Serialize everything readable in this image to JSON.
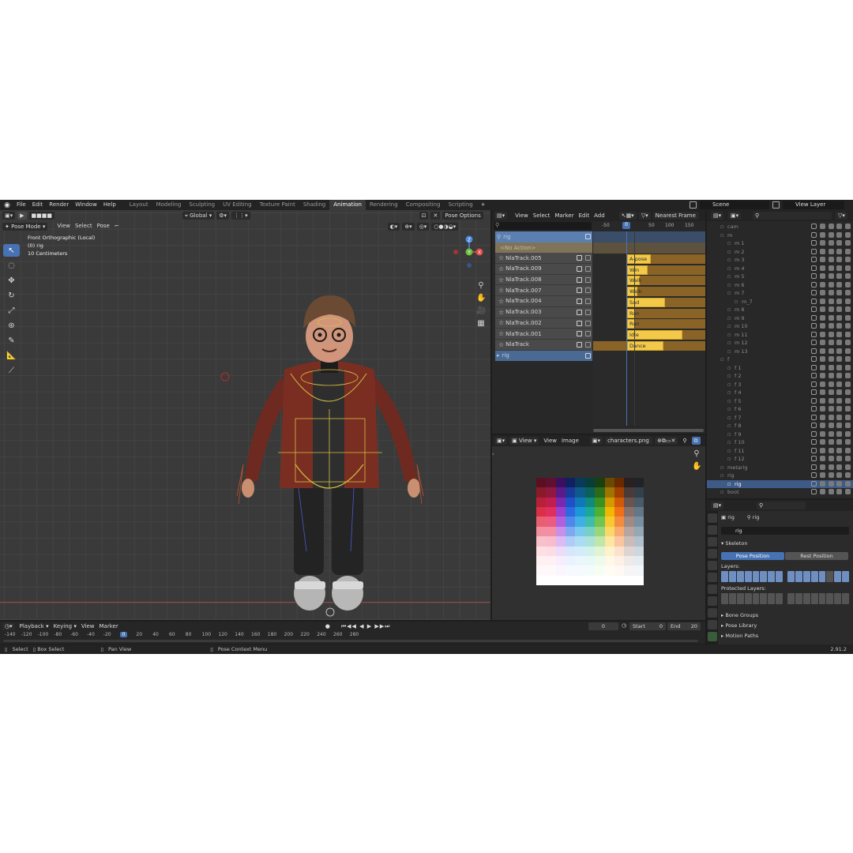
{
  "topbar": {
    "menus": [
      "File",
      "Edit",
      "Render",
      "Window",
      "Help"
    ],
    "workspaces": [
      "Layout",
      "Modeling",
      "Sculpting",
      "UV Editing",
      "Texture Paint",
      "Shading",
      "Animation",
      "Rendering",
      "Compositing",
      "Scripting"
    ],
    "active_workspace": "Animation",
    "add_tab": "+",
    "scene": "Scene",
    "view_layer": "View Layer"
  },
  "viewport": {
    "mode": "Pose Mode",
    "menus": [
      "View",
      "Select",
      "Pose"
    ],
    "transform_orientation": "Global",
    "pose_options": "Pose Options",
    "view_name": "Front Orthographic (Local)",
    "object_name": "(0) rig",
    "scale_text": "10 Centimeters",
    "gizmo": {
      "x": "X",
      "y": "Y",
      "z": "Z"
    }
  },
  "nla": {
    "menus": [
      "View",
      "Select",
      "Marker",
      "Edit",
      "Add"
    ],
    "snap": "Nearest Frame",
    "ruler": [
      "-50",
      "0",
      "50",
      "100",
      "150"
    ],
    "current_frame": "0",
    "rig_label": "rig",
    "no_action": "<No Action>",
    "tracks": [
      {
        "name": "NlaTrack.005",
        "strip": "A-pose",
        "value": 30
      },
      {
        "name": "NlaTrack.009",
        "strip": "Win",
        "value": 26
      },
      {
        "name": "NlaTrack.008",
        "strip": "Walk (I",
        "value": 16
      },
      {
        "name": "NlaTrack.007",
        "strip": "Walk",
        "value": 13
      },
      {
        "name": "NlaTrack.004",
        "strip": "Sad",
        "value": 48
      },
      {
        "name": "NlaTrack.003",
        "strip": "Run",
        "value": 7
      },
      {
        "name": "NlaTrack.002",
        "strip": "Run",
        "value": 7
      },
      {
        "name": "NlaTrack.001",
        "strip": "Idle",
        "value": 70
      },
      {
        "name": "NlaTrack",
        "strip": "Dance",
        "value": 46
      }
    ],
    "bottom_rig": "rig"
  },
  "image_editor": {
    "menus": [
      "View",
      "View",
      "Image"
    ],
    "image_name": "characters.png"
  },
  "outliner": {
    "rows": [
      {
        "name": "cam",
        "depth": 2,
        "sel": false
      },
      {
        "name": "m",
        "depth": 2,
        "sel": false
      },
      {
        "name": "m 1",
        "depth": 3,
        "sel": false
      },
      {
        "name": "m 2",
        "depth": 3,
        "sel": false
      },
      {
        "name": "m 3",
        "depth": 3,
        "sel": false
      },
      {
        "name": "m 4",
        "depth": 3,
        "sel": false
      },
      {
        "name": "m 5",
        "depth": 3,
        "sel": false
      },
      {
        "name": "m 6",
        "depth": 3,
        "sel": false
      },
      {
        "name": "m 7",
        "depth": 3,
        "sel": false
      },
      {
        "name": "m_7",
        "depth": 4,
        "sel": false
      },
      {
        "name": "m 8",
        "depth": 3,
        "sel": false
      },
      {
        "name": "m 9",
        "depth": 3,
        "sel": false
      },
      {
        "name": "m 10",
        "depth": 3,
        "sel": false
      },
      {
        "name": "m 11",
        "depth": 3,
        "sel": false
      },
      {
        "name": "m 12",
        "depth": 3,
        "sel": false
      },
      {
        "name": "m 13",
        "depth": 3,
        "sel": false
      },
      {
        "name": "f",
        "depth": 2,
        "sel": false
      },
      {
        "name": "f 1",
        "depth": 3,
        "sel": false
      },
      {
        "name": "f 2",
        "depth": 3,
        "sel": false
      },
      {
        "name": "f 3",
        "depth": 3,
        "sel": false
      },
      {
        "name": "f 4",
        "depth": 3,
        "sel": false
      },
      {
        "name": "f 5",
        "depth": 3,
        "sel": false
      },
      {
        "name": "f 6",
        "depth": 3,
        "sel": false
      },
      {
        "name": "f 7",
        "depth": 3,
        "sel": false
      },
      {
        "name": "f 8",
        "depth": 3,
        "sel": false
      },
      {
        "name": "f 9",
        "depth": 3,
        "sel": false
      },
      {
        "name": "f 10",
        "depth": 3,
        "sel": false
      },
      {
        "name": "f 11",
        "depth": 3,
        "sel": false
      },
      {
        "name": "f 12",
        "depth": 3,
        "sel": false
      },
      {
        "name": "metarig",
        "depth": 2,
        "sel": false
      },
      {
        "name": "rig",
        "depth": 2,
        "sel": false
      },
      {
        "name": "rig",
        "depth": 3,
        "sel": true
      },
      {
        "name": "boot",
        "depth": 2,
        "sel": false
      }
    ]
  },
  "properties": {
    "object": "rig",
    "data": "rig",
    "armature_name": "rig",
    "panel_skeleton": "Skeleton",
    "pose_position": "Pose Position",
    "rest_position": "Rest Position",
    "layers_label": "Layers:",
    "protected_layers_label": "Protected Layers:",
    "sections": [
      "Bone Groups",
      "Pose Library",
      "Motion Paths"
    ]
  },
  "timeline": {
    "menus": [
      "Playback",
      "Keying",
      "View",
      "Marker"
    ],
    "current_frame": "0",
    "start_label": "Start",
    "start": "0",
    "end_label": "End",
    "end": "20",
    "ticks": [
      "-140",
      "-120",
      "-100",
      "-80",
      "-60",
      "-40",
      "-20",
      "0",
      "20",
      "40",
      "60",
      "80",
      "100",
      "120",
      "140",
      "160",
      "180",
      "200",
      "220",
      "240",
      "260",
      "280"
    ]
  },
  "statusbar": {
    "select": "Select",
    "box_select": "Box Select",
    "pan_view": "Pan View",
    "context_menu": "Pose Context Menu",
    "version": "2.91.2"
  },
  "colors": {
    "accent": "#4772b3",
    "strip": "#f2c94a",
    "jacket": "#7a2e22"
  }
}
